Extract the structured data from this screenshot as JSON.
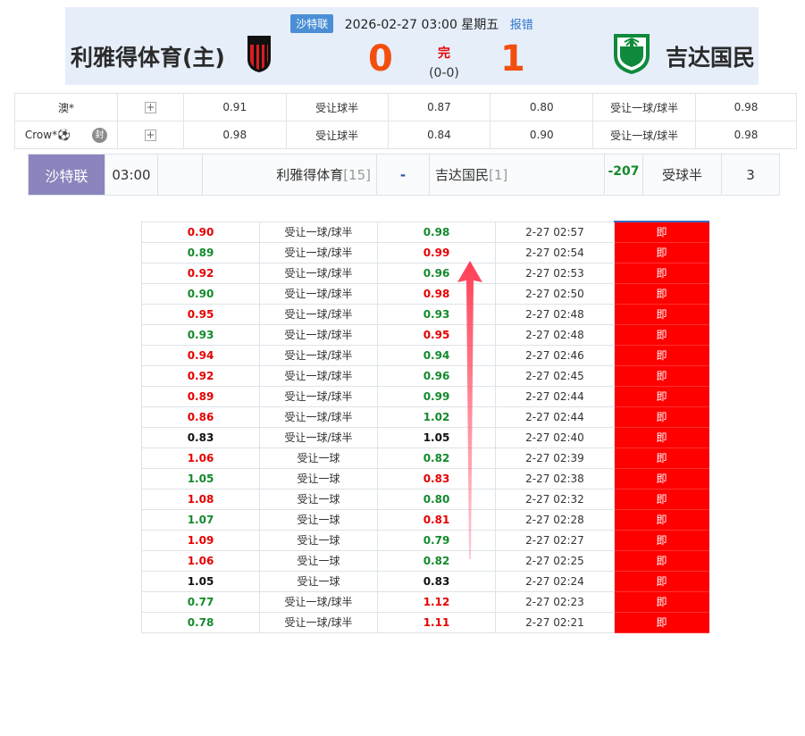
{
  "header": {
    "league": "沙特联",
    "datetime": "2026-02-27 03:00 星期五",
    "report": "报错",
    "home_team": "利雅得体育(主)",
    "away_team": "吉达国民",
    "home_score": "0",
    "away_score": "1",
    "status": "完",
    "halftime": "(0-0)"
  },
  "companies": [
    {
      "name": "澳*",
      "plus": "+",
      "o1": "0.91",
      "h1": "受让球半",
      "o2": "0.87",
      "o3": "0.80",
      "h2": "受让一球/球半",
      "o4": "0.98",
      "seal": ""
    },
    {
      "name": "Crow*⚽",
      "plus": "+",
      "o1": "0.98",
      "h1": "受让球半",
      "o2": "0.84",
      "o3": "0.90",
      "h2": "受让一球/球半",
      "o4": "0.98",
      "seal": "封"
    }
  ],
  "match_bar": {
    "league": "沙特联",
    "time": "03:00",
    "home": "利雅得体育",
    "home_rank": "[15]",
    "dash": "-",
    "away": "吉达国民",
    "away_rank": "[1]",
    "diff": "-207",
    "handicap": "受球半",
    "num": "3"
  },
  "history": [
    {
      "home": "0.90",
      "home_c": "red",
      "line": "受让一球/球半",
      "line_c": "",
      "away": "0.98",
      "away_c": "green",
      "time": "2-27 02:57",
      "tag": "即"
    },
    {
      "home": "0.89",
      "home_c": "green",
      "line": "受让一球/球半",
      "line_c": "",
      "away": "0.99",
      "away_c": "red",
      "time": "2-27 02:54",
      "tag": "即"
    },
    {
      "home": "0.92",
      "home_c": "red",
      "line": "受让一球/球半",
      "line_c": "",
      "away": "0.96",
      "away_c": "green",
      "time": "2-27 02:53",
      "tag": "即"
    },
    {
      "home": "0.90",
      "home_c": "green",
      "line": "受让一球/球半",
      "line_c": "",
      "away": "0.98",
      "away_c": "red",
      "time": "2-27 02:50",
      "tag": "即"
    },
    {
      "home": "0.95",
      "home_c": "red",
      "line": "受让一球/球半",
      "line_c": "",
      "away": "0.93",
      "away_c": "green",
      "time": "2-27 02:48",
      "tag": "即"
    },
    {
      "home": "0.93",
      "home_c": "green",
      "line": "受让一球/球半",
      "line_c": "",
      "away": "0.95",
      "away_c": "red",
      "time": "2-27 02:48",
      "tag": "即"
    },
    {
      "home": "0.94",
      "home_c": "red",
      "line": "受让一球/球半",
      "line_c": "",
      "away": "0.94",
      "away_c": "green",
      "time": "2-27 02:46",
      "tag": "即"
    },
    {
      "home": "0.92",
      "home_c": "red",
      "line": "受让一球/球半",
      "line_c": "",
      "away": "0.96",
      "away_c": "green",
      "time": "2-27 02:45",
      "tag": "即"
    },
    {
      "home": "0.89",
      "home_c": "red",
      "line": "受让一球/球半",
      "line_c": "",
      "away": "0.99",
      "away_c": "green",
      "time": "2-27 02:44",
      "tag": "即"
    },
    {
      "home": "0.86",
      "home_c": "red",
      "line": "受让一球/球半",
      "line_c": "",
      "away": "1.02",
      "away_c": "green",
      "time": "2-27 02:44",
      "tag": "即"
    },
    {
      "home": "0.83",
      "home_c": "black",
      "line": "受让一球/球半",
      "line_c": "green",
      "away": "1.05",
      "away_c": "black",
      "time": "2-27 02:40",
      "tag": "即"
    },
    {
      "home": "1.06",
      "home_c": "red",
      "line": "受让一球",
      "line_c": "",
      "away": "0.82",
      "away_c": "green",
      "time": "2-27 02:39",
      "tag": "即"
    },
    {
      "home": "1.05",
      "home_c": "green",
      "line": "受让一球",
      "line_c": "",
      "away": "0.83",
      "away_c": "red",
      "time": "2-27 02:38",
      "tag": "即"
    },
    {
      "home": "1.08",
      "home_c": "red",
      "line": "受让一球",
      "line_c": "",
      "away": "0.80",
      "away_c": "green",
      "time": "2-27 02:32",
      "tag": "即"
    },
    {
      "home": "1.07",
      "home_c": "green",
      "line": "受让一球",
      "line_c": "",
      "away": "0.81",
      "away_c": "red",
      "time": "2-27 02:28",
      "tag": "即"
    },
    {
      "home": "1.09",
      "home_c": "red",
      "line": "受让一球",
      "line_c": "",
      "away": "0.79",
      "away_c": "green",
      "time": "2-27 02:27",
      "tag": "即"
    },
    {
      "home": "1.06",
      "home_c": "red",
      "line": "受让一球",
      "line_c": "",
      "away": "0.82",
      "away_c": "green",
      "time": "2-27 02:25",
      "tag": "即"
    },
    {
      "home": "1.05",
      "home_c": "black",
      "line": "受让一球",
      "line_c": "red",
      "away": "0.83",
      "away_c": "black",
      "time": "2-27 02:24",
      "tag": "即"
    },
    {
      "home": "0.77",
      "home_c": "green",
      "line": "受让一球/球半",
      "line_c": "",
      "away": "1.12",
      "away_c": "red",
      "time": "2-27 02:23",
      "tag": "即"
    },
    {
      "home": "0.78",
      "home_c": "green",
      "line": "受让一球/球半",
      "line_c": "",
      "away": "1.11",
      "away_c": "red",
      "time": "2-27 02:21",
      "tag": "即"
    }
  ],
  "colors": {
    "accent_red": "#e60000",
    "accent_green": "#138a2c",
    "score_orange": "#f24f0f",
    "league_purple": "#8b85bd",
    "header_bg": "#e6eefa",
    "tag_red": "#ff0000"
  },
  "icons": {
    "home_logo": "club-crest-icon",
    "away_logo": "club-crest-icon",
    "arrow": "up-arrow-icon"
  }
}
